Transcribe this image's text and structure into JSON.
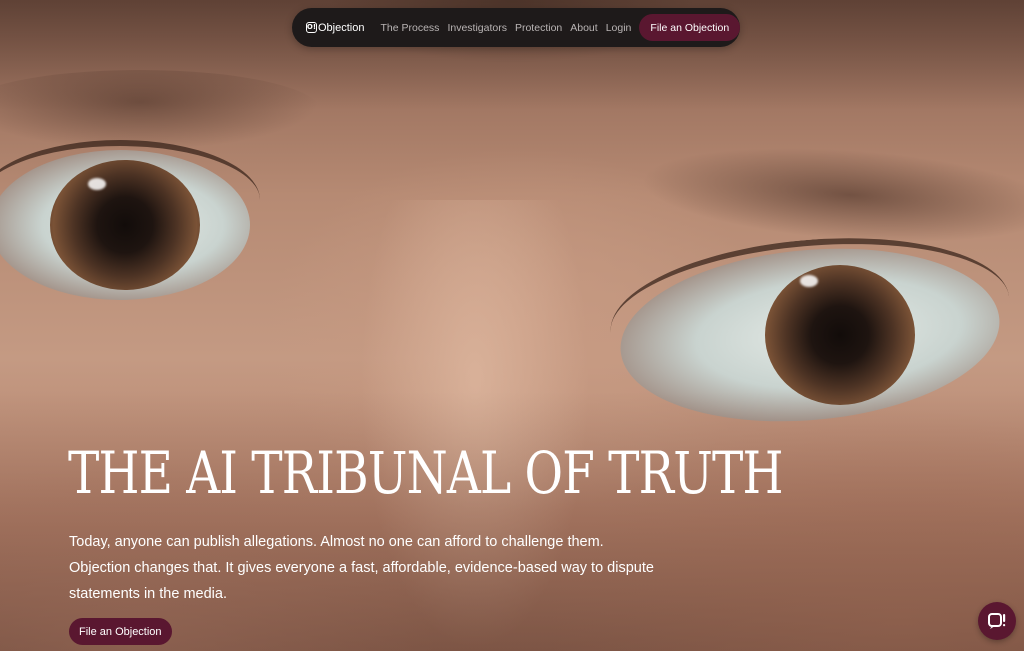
{
  "nav": {
    "logo_mark": "O!",
    "logo_text": "Objection",
    "links": [
      "The Process",
      "Investigators",
      "Protection",
      "About",
      "Login"
    ],
    "cta_label": "File an Objection"
  },
  "hero": {
    "headline": "THE AI TRIBUNAL OF TRUTH",
    "lede_line1": "Today, anyone can publish allegations. Almost no one can afford to challenge them.",
    "lede_line2": "Objection changes that. It gives everyone a fast, affordable, evidence-based way to dispute",
    "lede_line3": "statements in the media.",
    "cta_label": "File an Objection",
    "background_image": "painted-eyes-closeup"
  },
  "chat": {
    "icon": "chat-logo-icon"
  },
  "colors": {
    "nav_background": "#1e1a1a",
    "accent": "#5a1730",
    "text": "#ffffff",
    "nav_link": "#b9b4b4"
  }
}
